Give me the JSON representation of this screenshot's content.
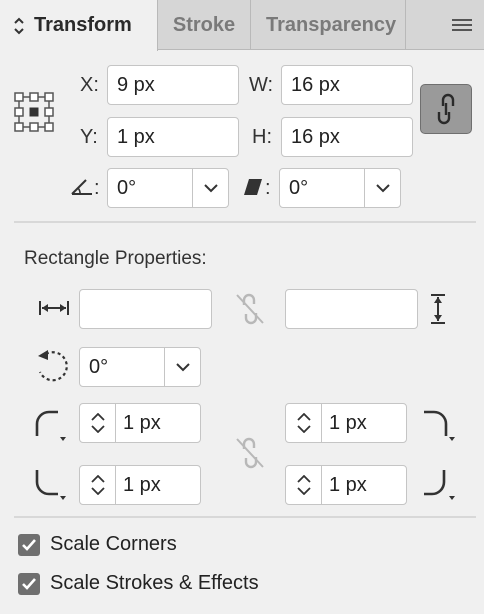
{
  "tabs": {
    "transform": "Transform",
    "stroke": "Stroke",
    "transparency": "Transparency"
  },
  "transform": {
    "x_label": "X:",
    "x_value": "9 px",
    "y_label": "Y:",
    "y_value": "1 px",
    "w_label": "W:",
    "w_value": "16 px",
    "h_label": "H:",
    "h_value": "16 px",
    "rotate_label": ":",
    "rotate_value": "0°",
    "shear_label": ":",
    "shear_value": "0°"
  },
  "rect": {
    "title": "Rectangle Properties:",
    "width_value": "",
    "height_value": "",
    "rotation_value": "0°",
    "corner_tl": "1 px",
    "corner_tr": "1 px",
    "corner_bl": "1 px",
    "corner_br": "1 px"
  },
  "options": {
    "scale_corners": "Scale Corners",
    "scale_strokes": "Scale Strokes & Effects"
  },
  "colors": {
    "panel_bg": "#f0f0f0",
    "tab_bg": "#d6d6d6",
    "checkbox_fill": "#6f6f6f",
    "link_button": "#9a9a9a"
  }
}
